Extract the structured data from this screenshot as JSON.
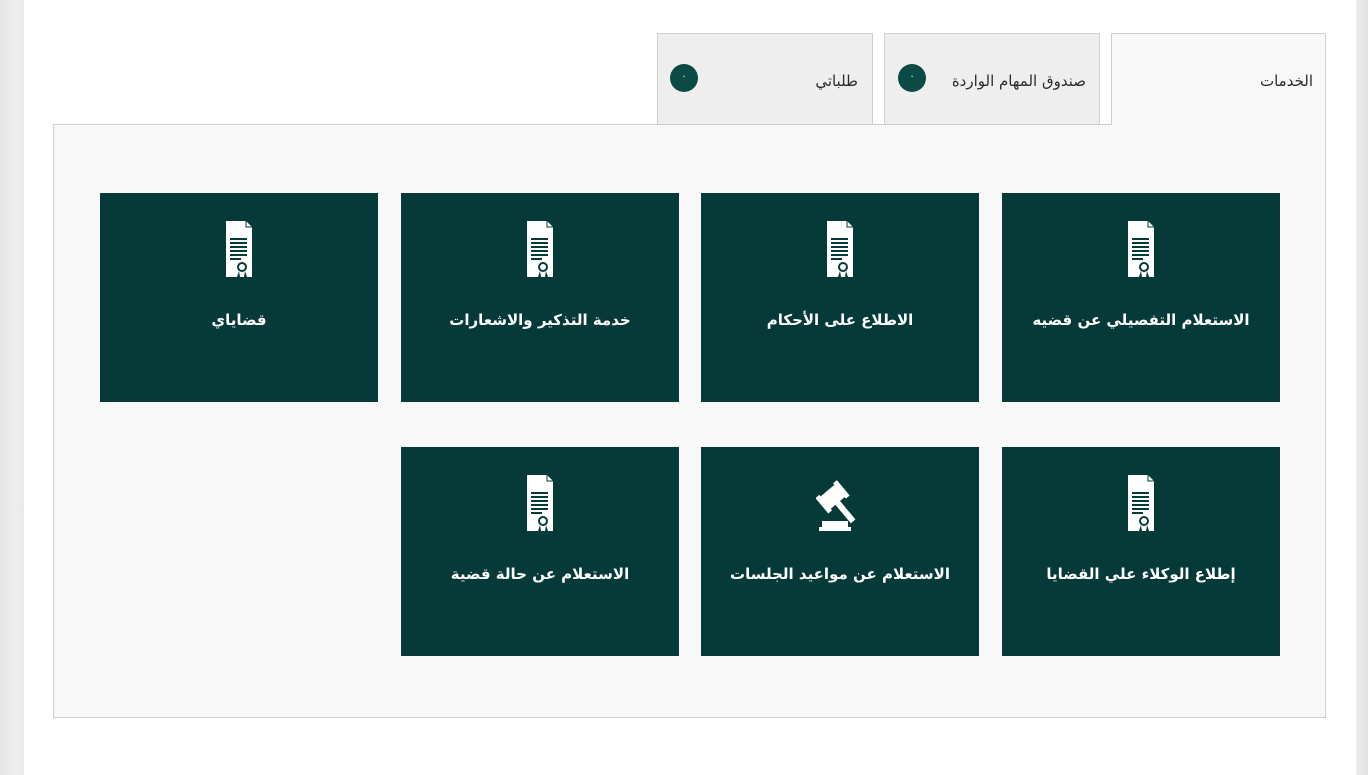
{
  "tabs": [
    {
      "label": "الخدمات",
      "active": true
    },
    {
      "label": "صندوق المهام الواردة",
      "badge": "٠"
    },
    {
      "label": "طلباتي",
      "badge": "٠"
    }
  ],
  "cards": [
    {
      "label": "الاستعلام التفصيلي عن قضيه",
      "icon": "document-certificate-icon"
    },
    {
      "label": "الاطلاع على الأحكام",
      "icon": "document-certificate-icon"
    },
    {
      "label": "خدمة التذكير والاشعارات",
      "icon": "document-certificate-icon"
    },
    {
      "label": "قضاياي",
      "icon": "document-certificate-icon"
    },
    {
      "label": "إطلاع الوكلاء علي القضايا",
      "icon": "document-certificate-icon"
    },
    {
      "label": "الاستعلام عن مواعيد الجلسات",
      "icon": "gavel-icon"
    },
    {
      "label": "الاستعلام عن حالة قضية",
      "icon": "document-certificate-icon"
    }
  ],
  "colors": {
    "card_background": "#063a38",
    "badge_background": "#0b4a45",
    "tab_background": "#eeeeee",
    "active_tab_background": "#f8f8f8"
  }
}
